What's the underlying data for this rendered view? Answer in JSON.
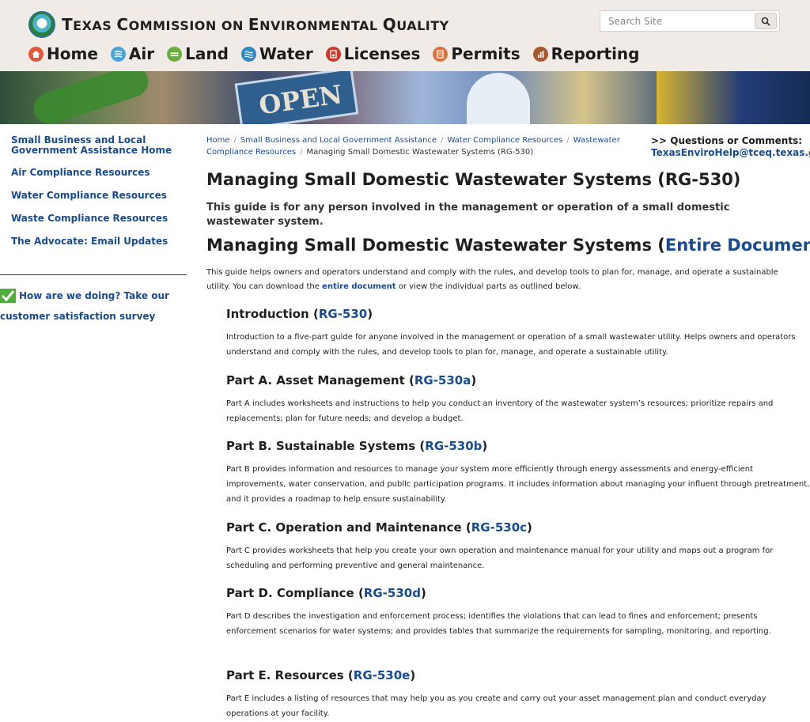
{
  "header": {
    "agency_name": "Texas Commission on Environmental Quality",
    "agency_name_parts": [
      {
        "cap": "T",
        "rest": "EXAS "
      },
      {
        "cap": "C",
        "rest": "OMMISSION ON "
      },
      {
        "cap": "E",
        "rest": "NVIRONMENTAL "
      },
      {
        "cap": "Q",
        "rest": "UALITY"
      }
    ],
    "search_placeholder": "Search Site",
    "nav": [
      {
        "label": "Home",
        "icon": "home-icon",
        "color": "#e0583c"
      },
      {
        "label": "Air",
        "icon": "air-icon",
        "color": "#4aa4d9"
      },
      {
        "label": "Land",
        "icon": "land-icon",
        "color": "#6aae3f"
      },
      {
        "label": "Water",
        "icon": "water-icon",
        "color": "#2f8ac4"
      },
      {
        "label": "Licenses",
        "icon": "licenses-icon",
        "color": "#c8392e"
      },
      {
        "label": "Permits",
        "icon": "permits-icon",
        "color": "#e2703a"
      },
      {
        "label": "Reporting",
        "icon": "reporting-icon",
        "color": "#a8582a"
      }
    ]
  },
  "banner": {
    "sign_text": "OPEN"
  },
  "sidebar": {
    "links": [
      "Small Business and Local Government Assistance Home",
      "Air Compliance Resources",
      "Water Compliance Resources",
      "Waste Compliance Resources",
      "The Advocate: Email Updates"
    ],
    "survey_line1": "How are we doing? Take our",
    "survey_line2": "customer satisfaction survey"
  },
  "breadcrumb": [
    "Home",
    "Small Business and Local Government Assistance",
    "Water Compliance Resources",
    "Wastewater Compliance Resources"
  ],
  "breadcrumb_current": "Managing Small Domestic Wastewater Systems (RG-530)",
  "questions": {
    "label": ">> Questions or Comments:",
    "email": "TexasEnviroHelp@tceq.texas.gov"
  },
  "main": {
    "title": "Managing Small Domestic Wastewater Systems (RG-530)",
    "lead": "This guide is for any person involved in the management or operation of a small domestic wastewater system.",
    "h2_prefix": "Managing Small Domestic Wastewater Systems (",
    "h2_link": "Entire Document",
    "h2_suffix": ")",
    "intro_before": "This guide helps owners and operators understand and comply with the rules, and develop tools to plan for, manage, and operate a sustainable utility. You can download the ",
    "intro_link": "entire document",
    "intro_after": " or view the individual parts as outlined below.",
    "sections": [
      {
        "title": "Introduction",
        "code": "RG-530",
        "text": "Introduction to a five-part guide for anyone involved in the management or operation of a small wastewater utility. Helps owners and operators understand and comply with the rules, and develop tools to plan for, manage, and operate a sustainable utility."
      },
      {
        "title": "Part A. Asset Management",
        "code": "RG-530a",
        "text": "Part A includes worksheets and instructions to help you conduct an inventory of the wastewater system’s resources; prioritize repairs and replacements; plan for future needs; and develop a budget."
      },
      {
        "title": "Part B. Sustainable Systems",
        "code": "RG-530b",
        "text": "Part B provides information and resources to manage your system more efficiently through energy assessments and energy-efficient improvements, water conservation, and public participation programs. It includes information about managing your influent through pretreatment, and it provides a roadmap to help ensure sustainability."
      },
      {
        "title": "Part C. Operation and Maintenance",
        "code": "RG-530c",
        "text": "Part C provides worksheets that help you create your own operation and maintenance manual for your utility and maps out a program for scheduling and performing preventive and general maintenance."
      },
      {
        "title": "Part D. Compliance",
        "code": "RG-530d",
        "text": "Part D describes the investigation and enforcement process; identifies the violations that can lead to fines and enforcement; presents enforcement scenarios for water systems; and provides tables that summarize the requirements for sampling, monitoring, and reporting."
      },
      {
        "title": "Part E. Resources",
        "code": "RG-530e",
        "text": "Part E includes a listing of resources that may help you as you create and carry out your asset management plan and conduct everyday operations at your facility."
      }
    ]
  }
}
